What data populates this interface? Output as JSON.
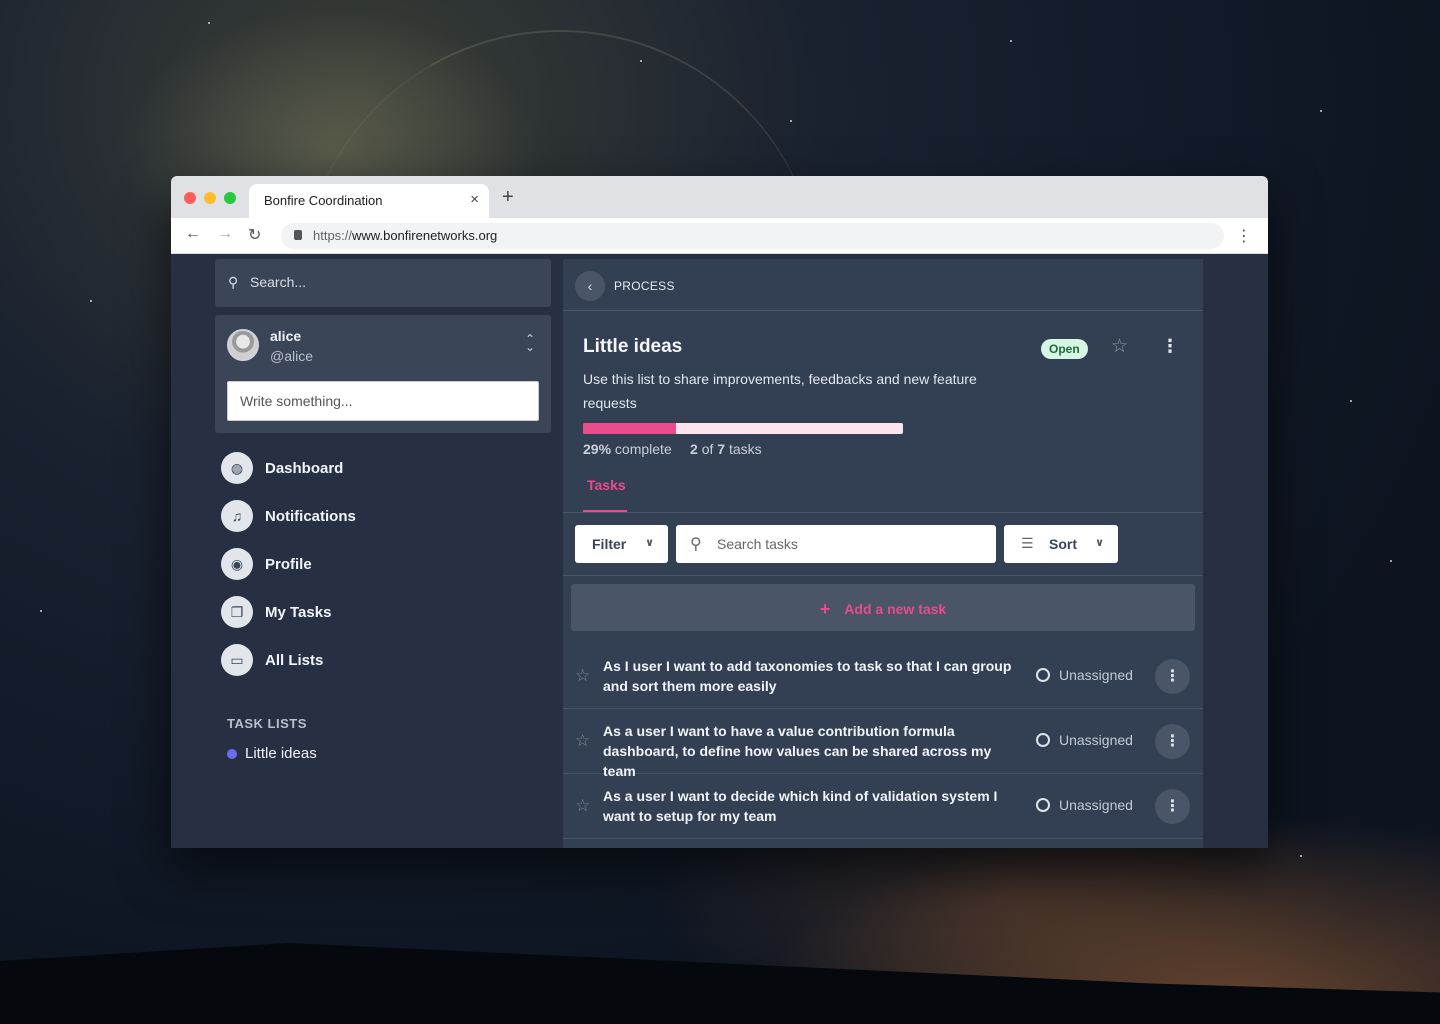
{
  "browser": {
    "tab_title": "Bonfire Coordination",
    "tab_close": "×",
    "new_tab": "+",
    "url_scheme": "https://",
    "url_host": "www.bonfirenetworks.org"
  },
  "sidebar": {
    "search_placeholder": "Search...",
    "user": {
      "name": "alice",
      "handle": "@alice"
    },
    "composer_placeholder": "Write something...",
    "nav": [
      {
        "label": "Dashboard",
        "icon": "dashboard-icon"
      },
      {
        "label": "Notifications",
        "icon": "bell-icon"
      },
      {
        "label": "Profile",
        "icon": "user-circle-icon"
      },
      {
        "label": "My Tasks",
        "icon": "copy-icon"
      },
      {
        "label": "All Lists",
        "icon": "archive-icon"
      }
    ],
    "task_lists_heading": "TASK LISTS",
    "task_lists": [
      {
        "label": "Little ideas",
        "color": "#6a6cf0"
      }
    ]
  },
  "main": {
    "back_label": "PROCESS",
    "title": "Little ideas",
    "description": "Use this list to share improvements, feedbacks and new feature requests",
    "status": "Open",
    "progress": {
      "percent": 29,
      "percent_label": "29%",
      "complete_label": "complete",
      "done": "2",
      "of": "of",
      "total": "7",
      "tasks_label": "tasks"
    },
    "tab": "Tasks",
    "filter_label": "Filter",
    "search_placeholder": "Search tasks",
    "sort_label": "Sort",
    "add_task_label": "Add a new task",
    "tasks": [
      {
        "text": "As I user I want to add taxonomies to task so that I can group and sort them more easily",
        "assignee": "Unassigned"
      },
      {
        "text": "As a user I want to have a value contribution formula dashboard, to define how values can be shared across my team",
        "assignee": "Unassigned"
      },
      {
        "text": "As a user I want to decide which kind of validation system I want to setup for my team",
        "assignee": "Unassigned"
      }
    ]
  },
  "colors": {
    "accent": "#e84c8b",
    "status_open_bg": "#d6f5e3",
    "sidebar_bg": "#263042",
    "panel_bg": "#333f52"
  }
}
